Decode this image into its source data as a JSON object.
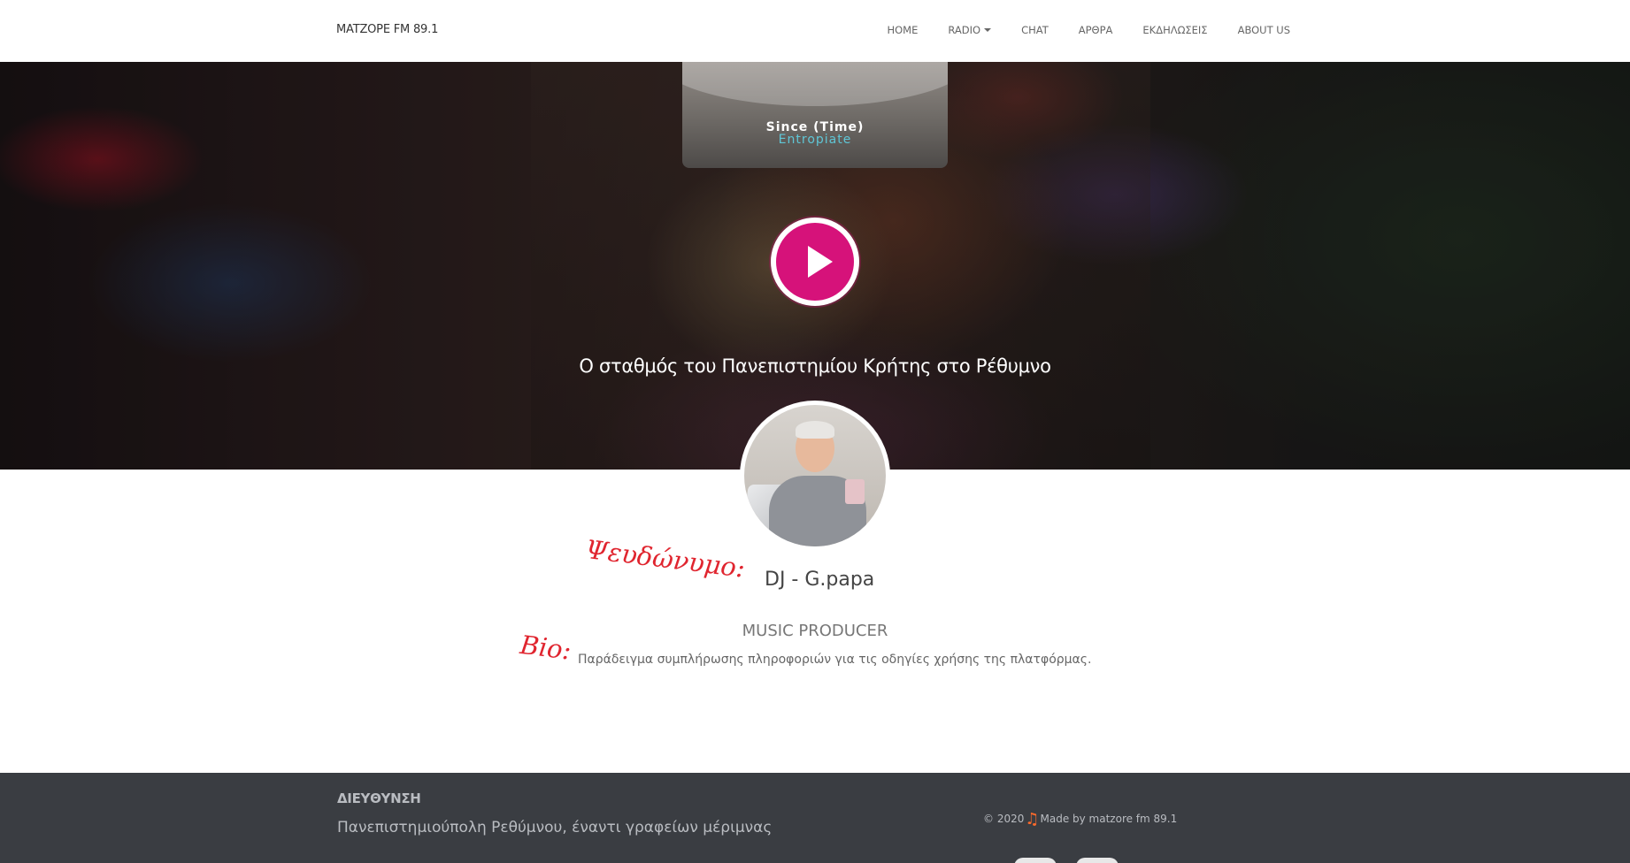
{
  "navbar": {
    "brand": "MATZOPE FM 89.1",
    "items": [
      {
        "label": "HOME"
      },
      {
        "label": "RADIO"
      },
      {
        "label": "CHAT"
      },
      {
        "label": "ΑΡΘΡΑ"
      },
      {
        "label": "ΕΚΔΗΛΩΣΕΙΣ"
      },
      {
        "label": "ABOUT US"
      }
    ]
  },
  "now_playing": {
    "title": "Since (Time)",
    "artist": "Entropiate"
  },
  "hero": {
    "tagline": "Ο σταθμός του Πανεπιστημίου Κρήτης στο Ρέθυμνο"
  },
  "profile": {
    "nickname_label": "Ψευδώνυμο:",
    "nickname": "DJ - G.papa",
    "role": "MUSIC PRODUCER",
    "bio_label": "Bio:",
    "bio": "Παράδειγμα συμπλήρωσης πληροφοριών για τις οδηγίες χρήσης της πλατφόρμας."
  },
  "footer": {
    "title": "ΔΙΕΥΘΥΝΣΗ",
    "address": "Πανεπιστημιούπολη Ρεθύμνου, έναντι γραφείων μέριμνας",
    "copyright_prefix": "© 2020",
    "copyright_suffix": "Made by matzore fm 89.1"
  },
  "colors": {
    "accent": "#d6127a",
    "label_red": "#e0252f",
    "footer_bg": "#3a3d42",
    "note_orange": "#ff6a2b"
  }
}
